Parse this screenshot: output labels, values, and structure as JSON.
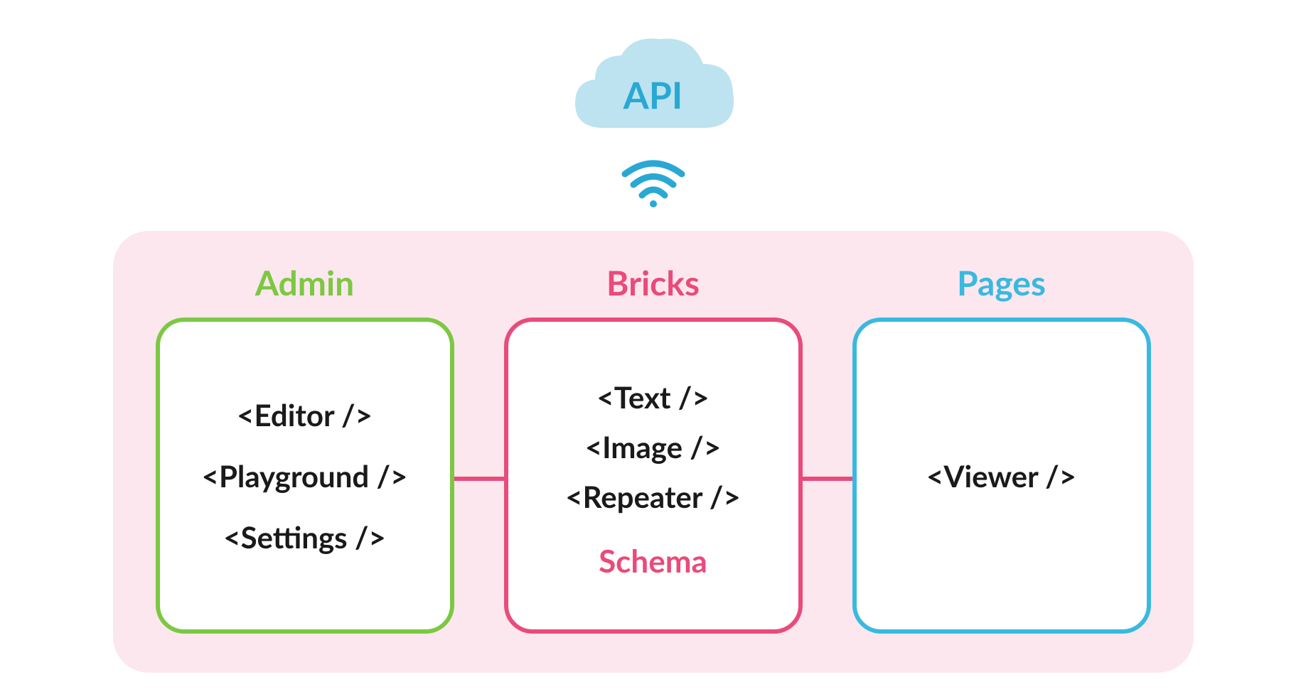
{
  "api": {
    "label": "API"
  },
  "sections": {
    "admin": {
      "title": "Admin",
      "items": [
        "<Editor />",
        "<Playground />",
        "<Settings />"
      ]
    },
    "bricks": {
      "title": "Bricks",
      "items": [
        "<Text />",
        "<Image />",
        "<Repeater />"
      ],
      "footer": "Schema"
    },
    "pages": {
      "title": "Pages",
      "items": [
        "<Viewer />"
      ]
    }
  },
  "colors": {
    "cloudFill": "#bce3ef",
    "cloudText": "#2aa8d4",
    "wifi": "#2aa8d4",
    "containerBg": "#fde7ef",
    "green": "#7cc842",
    "pink": "#e94b7a",
    "blue": "#39b9e0",
    "text": "#1a1a1a"
  }
}
